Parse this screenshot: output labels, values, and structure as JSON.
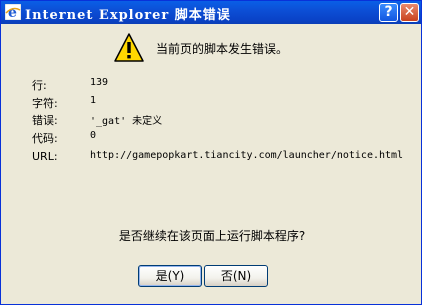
{
  "window": {
    "title": "Internet Explorer 脚本错误",
    "help_label": "?",
    "close_label": "✕"
  },
  "message": "当前页的脚本发生错误。",
  "details": [
    {
      "label": "行:",
      "value": "139"
    },
    {
      "label": "字符:",
      "value": "1"
    },
    {
      "label": "错误:",
      "value": "'_gat' 未定义"
    },
    {
      "label": "代码:",
      "value": "0"
    },
    {
      "label": "URL:",
      "value": "http://gamepopkart.tiancity.com/launcher/notice.html"
    }
  ],
  "question": "是否继续在该页面上运行脚本程序?",
  "buttons": {
    "yes": "是(Y)",
    "no": "否(N)"
  },
  "icons": {
    "title": "internet-explorer-icon",
    "warning": "warning-icon"
  }
}
